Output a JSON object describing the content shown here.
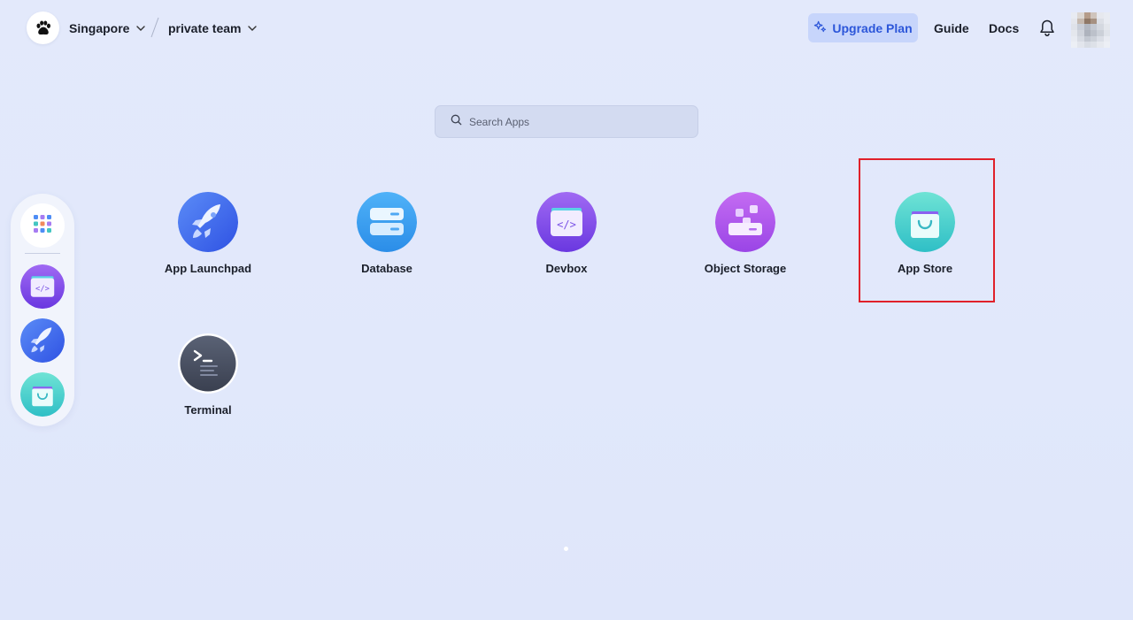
{
  "header": {
    "region": "Singapore",
    "team": "private team",
    "upgrade_label": "Upgrade Plan",
    "guide_label": "Guide",
    "docs_label": "Docs",
    "icons": [
      "paw-logo-icon",
      "chevron-down-icon",
      "sparkle-icon",
      "bell-icon"
    ]
  },
  "search": {
    "placeholder": "Search Apps"
  },
  "dock": {
    "items": [
      {
        "name": "all-apps"
      },
      {
        "name": "devbox"
      },
      {
        "name": "app-launchpad"
      },
      {
        "name": "app-store"
      }
    ]
  },
  "apps": [
    {
      "label": "App Launchpad"
    },
    {
      "label": "Database"
    },
    {
      "label": "Devbox"
    },
    {
      "label": "Object Storage"
    },
    {
      "label": "App Store"
    },
    {
      "label": "Terminal"
    }
  ],
  "colors": {
    "accent": "#2c56d9",
    "highlight": "#e0202a",
    "background": "#e1e8fb"
  }
}
